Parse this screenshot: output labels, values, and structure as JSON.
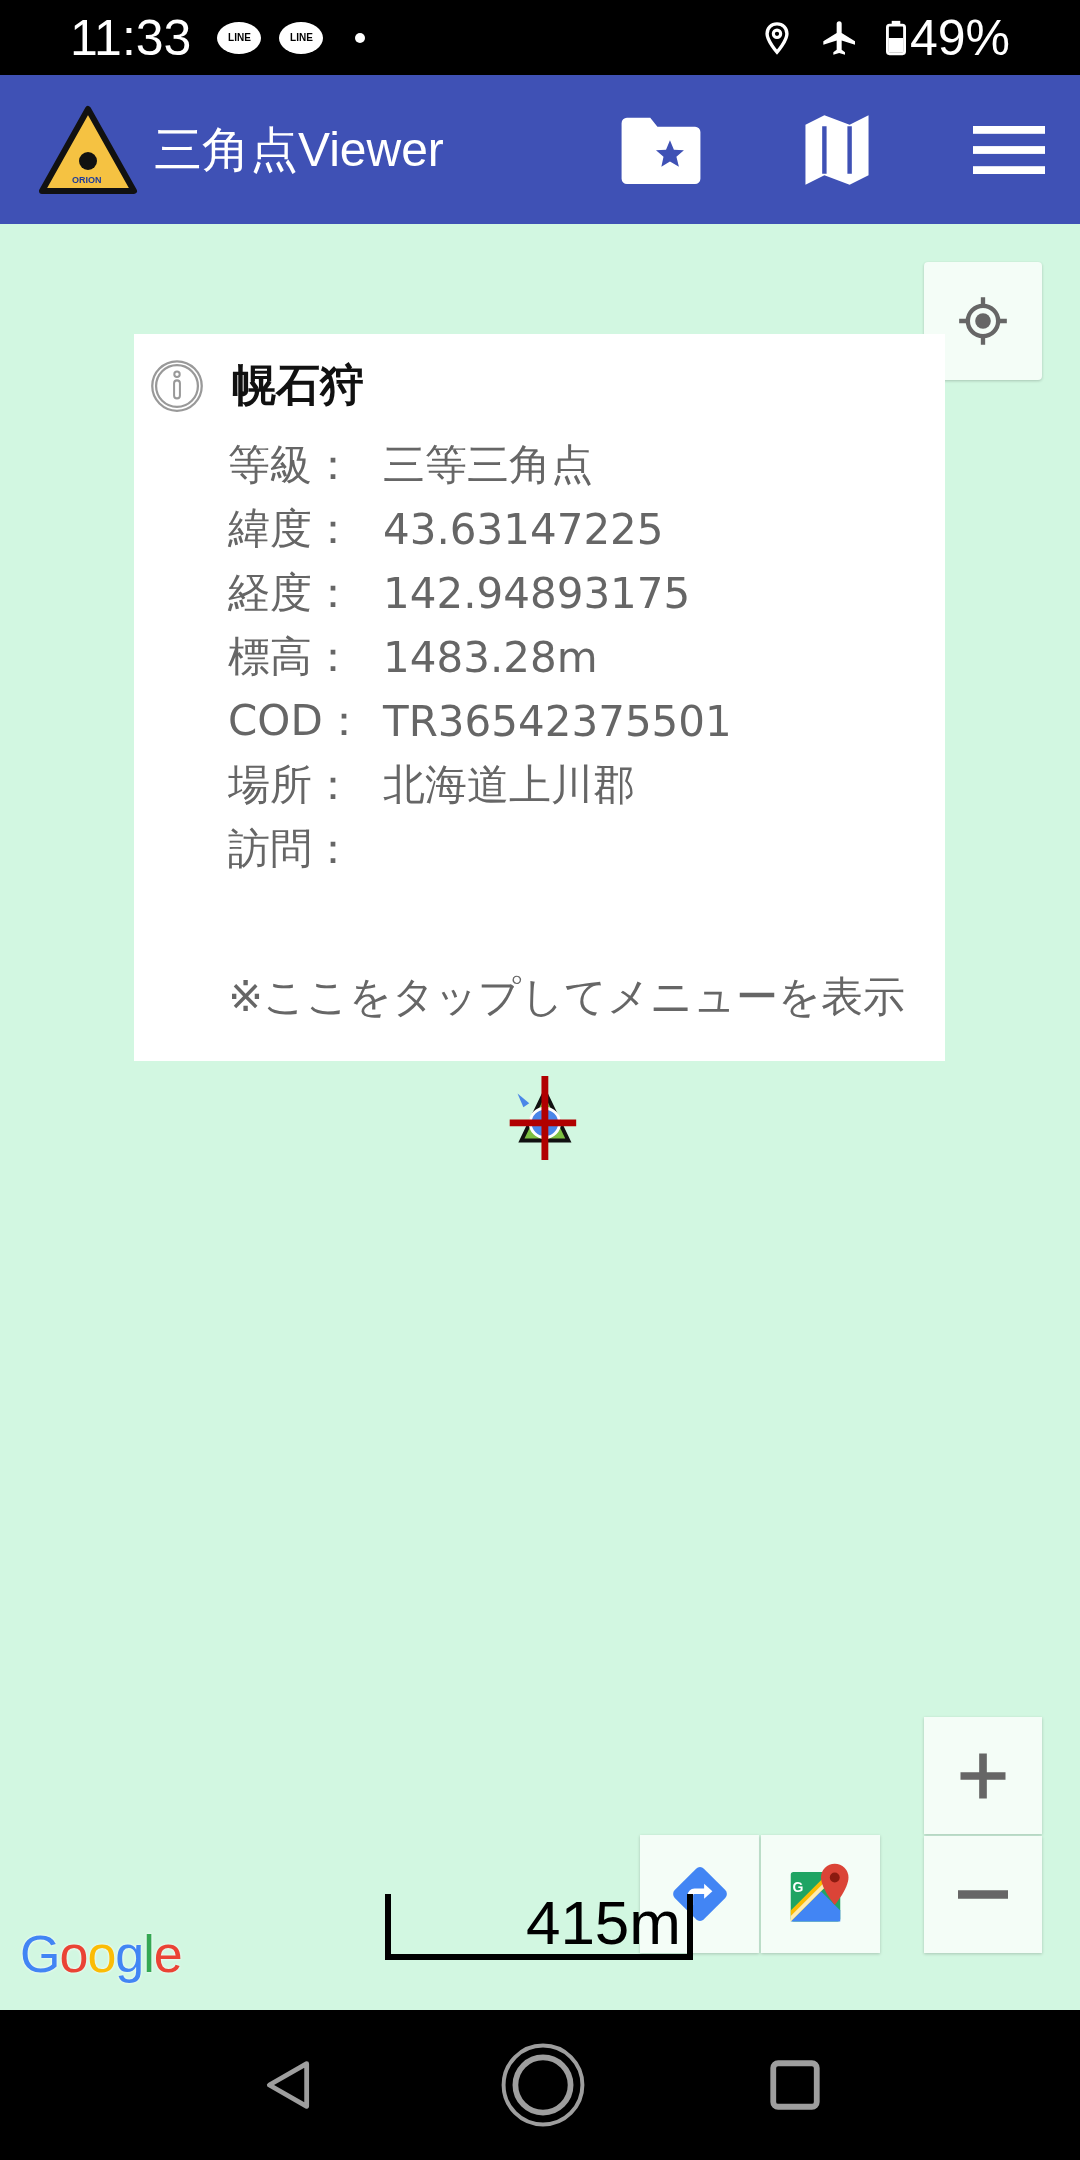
{
  "status_bar": {
    "time": "11:33",
    "notifications": [
      {
        "label": "LINE"
      },
      {
        "label": "LINE"
      }
    ],
    "battery": "49%"
  },
  "app_bar": {
    "logo_text": "ORION",
    "title": "三角点Viewer"
  },
  "info_card": {
    "title": "幌石狩",
    "rows": [
      {
        "label": "等級：",
        "value": "三等三角点"
      },
      {
        "label": "緯度：",
        "value": "43.63147225"
      },
      {
        "label": "経度：",
        "value": "142.94893175"
      },
      {
        "label": "標高：",
        "value": "1483.28m"
      },
      {
        "label": "COD：",
        "value": "TR36542375501"
      },
      {
        "label": "場所：",
        "value": "北海道上川郡"
      },
      {
        "label": "訪問："
      }
    ],
    "hint": "※ここをタップしてメニューを表示"
  },
  "map": {
    "scale": "415m",
    "attribution": "Google",
    "maps_icon_letter": "G"
  }
}
